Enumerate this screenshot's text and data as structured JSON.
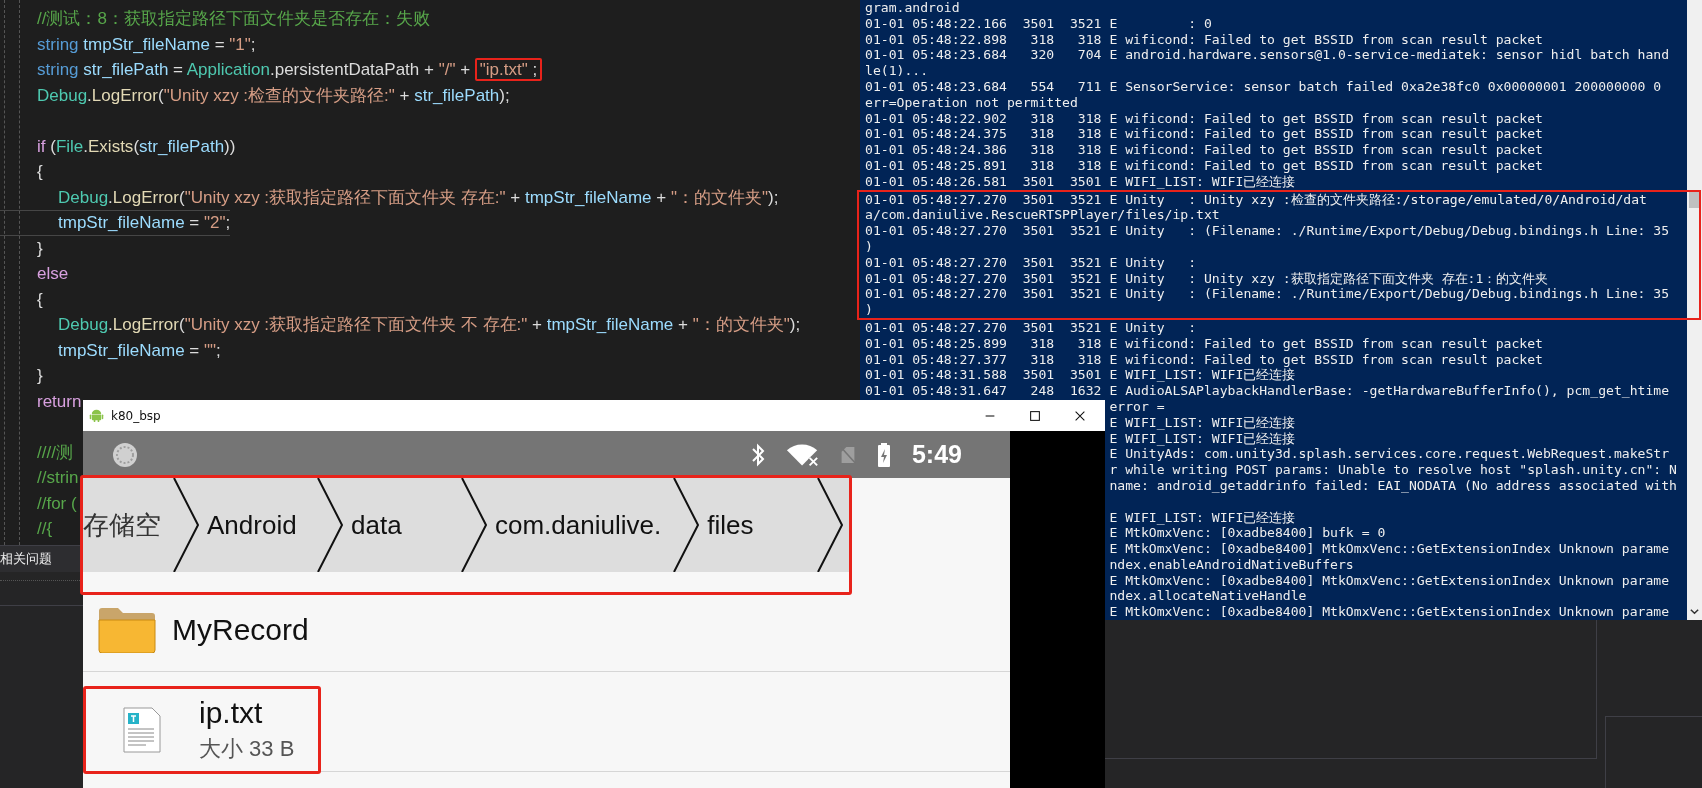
{
  "editor": {
    "lines": [
      {
        "kind": "code",
        "current": false,
        "tokens": [
          {
            "kind": "comment",
            "text": "//测试：8：获取指定路径下面文件夹是否存在：失败"
          }
        ]
      },
      {
        "kind": "code",
        "current": false,
        "tokens": [
          {
            "kind": "keyword",
            "text": "string "
          },
          {
            "kind": "ident",
            "text": "tmpStr_fileName"
          },
          {
            "kind": "plain",
            "text": " = "
          },
          {
            "kind": "string",
            "text": "\"1\""
          },
          {
            "kind": "plain",
            "text": ";"
          }
        ]
      },
      {
        "kind": "code",
        "current": false,
        "tokens": [
          {
            "kind": "keyword",
            "text": "string "
          },
          {
            "kind": "ident",
            "text": "str_filePath"
          },
          {
            "kind": "plain",
            "text": " = "
          },
          {
            "kind": "type",
            "text": "Application"
          },
          {
            "kind": "plain",
            "text": ".persistentDataPath + "
          },
          {
            "kind": "string",
            "text": "\"/\""
          },
          {
            "kind": "plain",
            "text": " + "
          },
          {
            "kind": "mark",
            "highlighted": true,
            "tokens": [
              {
                "kind": "string",
                "text": "\"ip.txt\""
              },
              {
                "kind": "plain",
                "text": " ;"
              }
            ]
          }
        ]
      },
      {
        "kind": "code",
        "current": false,
        "tokens": [
          {
            "kind": "type",
            "text": "Debug"
          },
          {
            "kind": "plain",
            "text": "."
          },
          {
            "kind": "method",
            "text": "LogError"
          },
          {
            "kind": "plain",
            "text": "("
          },
          {
            "kind": "string",
            "text": "\"Unity xzy :检查的文件夹路径:\""
          },
          {
            "kind": "plain",
            "text": " + "
          },
          {
            "kind": "ident",
            "text": "str_filePath"
          },
          {
            "kind": "plain",
            "text": ");"
          }
        ]
      },
      {
        "kind": "blank"
      },
      {
        "kind": "code",
        "current": false,
        "tokens": [
          {
            "kind": "control",
            "text": "if"
          },
          {
            "kind": "plain",
            "text": " ("
          },
          {
            "kind": "type",
            "text": "File"
          },
          {
            "kind": "plain",
            "text": "."
          },
          {
            "kind": "method",
            "text": "Exists"
          },
          {
            "kind": "plain",
            "text": "("
          },
          {
            "kind": "ident",
            "text": "str_filePath"
          },
          {
            "kind": "plain",
            "text": "))"
          }
        ]
      },
      {
        "kind": "code",
        "current": false,
        "tokens": [
          {
            "kind": "plain",
            "text": "{"
          }
        ],
        "children": [
          {
            "kind": "code",
            "current": false,
            "tokens": [
              {
                "kind": "type",
                "text": "Debug"
              },
              {
                "kind": "plain",
                "text": "."
              },
              {
                "kind": "method",
                "text": "LogError"
              },
              {
                "kind": "plain",
                "text": "("
              },
              {
                "kind": "string",
                "text": "\"Unity xzy :获取指定路径下面文件夹 存在:\""
              },
              {
                "kind": "plain",
                "text": " + "
              },
              {
                "kind": "ident",
                "text": "tmpStr_fileName"
              },
              {
                "kind": "plain",
                "text": " + "
              },
              {
                "kind": "string",
                "text": "\"：的文件夹\""
              },
              {
                "kind": "plain",
                "text": ");"
              }
            ]
          },
          {
            "kind": "code",
            "current": true,
            "tokens": [
              {
                "kind": "ident",
                "text": "tmpStr_fileName"
              },
              {
                "kind": "plain",
                "text": " = "
              },
              {
                "kind": "string",
                "text": "\"2\""
              },
              {
                "kind": "plain",
                "text": ";"
              }
            ]
          }
        ]
      },
      {
        "kind": "code",
        "current": false,
        "tokens": [
          {
            "kind": "plain",
            "text": "}"
          }
        ]
      },
      {
        "kind": "code",
        "current": false,
        "tokens": [
          {
            "kind": "control",
            "text": "else"
          }
        ]
      },
      {
        "kind": "code",
        "current": false,
        "tokens": [
          {
            "kind": "plain",
            "text": "{"
          }
        ],
        "children": [
          {
            "kind": "code",
            "current": false,
            "tokens": [
              {
                "kind": "type",
                "text": "Debug"
              },
              {
                "kind": "plain",
                "text": "."
              },
              {
                "kind": "method",
                "text": "LogError"
              },
              {
                "kind": "plain",
                "text": "("
              },
              {
                "kind": "string",
                "text": "\"Unity xzy :获取指定路径下面文件夹 不 存在:\""
              },
              {
                "kind": "plain",
                "text": " + "
              },
              {
                "kind": "ident",
                "text": "tmpStr_fileName"
              },
              {
                "kind": "plain",
                "text": " + "
              },
              {
                "kind": "string",
                "text": "\"：的文件夹\""
              },
              {
                "kind": "plain",
                "text": ");"
              }
            ]
          },
          {
            "kind": "code",
            "current": false,
            "tokens": [
              {
                "kind": "ident",
                "text": "tmpStr_fileName"
              },
              {
                "kind": "plain",
                "text": " = "
              },
              {
                "kind": "string",
                "text": "\"\""
              },
              {
                "kind": "plain",
                "text": ";"
              }
            ]
          }
        ]
      },
      {
        "kind": "code",
        "current": false,
        "tokens": [
          {
            "kind": "plain",
            "text": "}"
          }
        ]
      },
      {
        "kind": "code",
        "current": false,
        "tokens": [
          {
            "kind": "control",
            "text": "return"
          }
        ]
      },
      {
        "kind": "blank"
      },
      {
        "kind": "code",
        "current": false,
        "tokens": [
          {
            "kind": "comment",
            "text": "////测"
          }
        ]
      },
      {
        "kind": "code",
        "current": false,
        "tokens": [
          {
            "kind": "comment",
            "text": "//strin"
          }
        ]
      },
      {
        "kind": "code",
        "current": false,
        "tokens": [
          {
            "kind": "comment",
            "text": "//for ("
          }
        ]
      },
      {
        "kind": "code",
        "current": false,
        "tokens": [
          {
            "kind": "comment",
            "text": "//{"
          }
        ]
      }
    ]
  },
  "ide_panel": {
    "title": "相关问题"
  },
  "console": {
    "blocks": [
      {
        "highlighted": false,
        "rows": [
          {
            "kind": "full",
            "text": "gram.android"
          },
          {
            "kind": "full",
            "text": "01-01 05:48:22.166  3501  3521 E         : 0"
          },
          {
            "kind": "full",
            "text": "01-01 05:48:22.898   318   318 E wificond: Failed to get BSSID from scan result packet"
          },
          {
            "kind": "full",
            "text": "01-01 05:48:23.684   320   704 E android.hardware.sensors@1.0-service-mediatek: sensor hidl batch hand"
          },
          {
            "kind": "full",
            "text": "le(1)..."
          },
          {
            "kind": "full",
            "text": "01-01 05:48:23.684   554   711 E SensorService: sensor batch failed 0xa2e38fc0 0x00000001 200000000 0"
          },
          {
            "kind": "full",
            "text": "err=Operation not permitted"
          },
          {
            "kind": "full",
            "text": "01-01 05:48:22.902   318   318 E wificond: Failed to get BSSID from scan result packet"
          },
          {
            "kind": "full",
            "text": "01-01 05:48:24.375   318   318 E wificond: Failed to get BSSID from scan result packet"
          },
          {
            "kind": "full",
            "text": "01-01 05:48:24.386   318   318 E wificond: Failed to get BSSID from scan result packet"
          },
          {
            "kind": "full",
            "text": "01-01 05:48:25.891   318   318 E wificond: Failed to get BSSID from scan result packet"
          },
          {
            "kind": "full",
            "text": "01-01 05:48:26.581  3501  3501 E WIFI_LIST: WIFI已经连接"
          }
        ]
      },
      {
        "highlighted": true,
        "rows": [
          {
            "kind": "full",
            "text": "01-01 05:48:27.270  3501  3521 E Unity   : Unity xzy :检查的文件夹路径:/storage/emulated/0/Android/dat"
          },
          {
            "kind": "full",
            "text": "a/com.daniulive.RescueRTSPPlayer/files/ip.txt"
          },
          {
            "kind": "full",
            "text": "01-01 05:48:27.270  3501  3521 E Unity   : (Filename: ./Runtime/Export/Debug/Debug.bindings.h Line: 35"
          },
          {
            "kind": "full",
            "text": ")"
          },
          {
            "kind": "full",
            "text": "01-01 05:48:27.270  3501  3521 E Unity   :"
          },
          {
            "kind": "full",
            "text": "01-01 05:48:27.270  3501  3521 E Unity   : Unity xzy :获取指定路径下面文件夹 存在:1：的文件夹"
          },
          {
            "kind": "full",
            "text": "01-01 05:48:27.270  3501  3521 E Unity   : (Filename: ./Runtime/Export/Debug/Debug.bindings.h Line: 35"
          },
          {
            "kind": "full",
            "text": ")"
          }
        ]
      },
      {
        "highlighted": false,
        "rows": [
          {
            "kind": "full",
            "text": "01-01 05:48:27.270  3501  3521 E Unity   :"
          },
          {
            "kind": "full",
            "text": "01-01 05:48:25.899   318   318 E wificond: Failed to get BSSID from scan result packet"
          },
          {
            "kind": "full",
            "text": "01-01 05:48:27.377   318   318 E wificond: Failed to get BSSID from scan result packet"
          },
          {
            "kind": "full",
            "text": "01-01 05:48:31.588  3501  3501 E WIFI_LIST: WIFI已经连接"
          },
          {
            "kind": "full",
            "text": "01-01 05:48:31.647   248  1632 E AudioALSAPlaybackHandlerBase: -getHardwareBufferInfo(), pcm_get_htime"
          },
          {
            "kind": "partial",
            "text": "error ="
          },
          {
            "kind": "partial",
            "text": "E WIFI_LIST: WIFI已经连接"
          },
          {
            "kind": "partial",
            "text": "E WIFI_LIST: WIFI已经连接"
          },
          {
            "kind": "partial",
            "text": "E UnityAds: com.unity3d.splash.services.core.request.WebRequest.makeStr"
          },
          {
            "kind": "partial",
            "text": "r while writing POST params: Unable to resolve host \"splash.unity.cn\": N"
          },
          {
            "kind": "partial",
            "text": "name: android_getaddrinfo failed: EAI_NODATA (No address associated with"
          },
          {
            "kind": "blank"
          },
          {
            "kind": "partial",
            "text": "E WIFI_LIST: WIFI已经连接"
          },
          {
            "kind": "partial",
            "text": "E MtkOmxVenc: [0xadbe8400] bufk = 0"
          },
          {
            "kind": "partial",
            "text": "E MtkOmxVenc: [0xadbe8400] MtkOmxVenc::GetExtensionIndex Unknown parame"
          },
          {
            "kind": "partial",
            "text": "ndex.enableAndroidNativeBuffers"
          },
          {
            "kind": "partial",
            "text": "E MtkOmxVenc: [0xadbe8400] MtkOmxVenc::GetExtensionIndex Unknown parame"
          },
          {
            "kind": "partial",
            "text": "ndex.allocateNativeHandle"
          },
          {
            "kind": "partial",
            "text": "E MtkOmxVenc: [0xadbe8400] MtkOmxVenc::GetExtensionIndex Unknown parame"
          }
        ]
      }
    ]
  },
  "emulator": {
    "title": "k80_bsp",
    "status_bar": {
      "time": "5:49"
    },
    "breadcrumb": {
      "highlighted": true,
      "items": [
        {
          "label": "存储空"
        },
        {
          "label": "Android"
        },
        {
          "label": "data"
        },
        {
          "label": "com.daniulive."
        },
        {
          "label": "files"
        }
      ]
    },
    "files": [
      {
        "kind": "folder",
        "name": "MyRecord",
        "highlighted": false
      },
      {
        "kind": "text-file",
        "name": "ip.txt",
        "detail": "大小 33 B",
        "highlighted": true
      }
    ]
  }
}
